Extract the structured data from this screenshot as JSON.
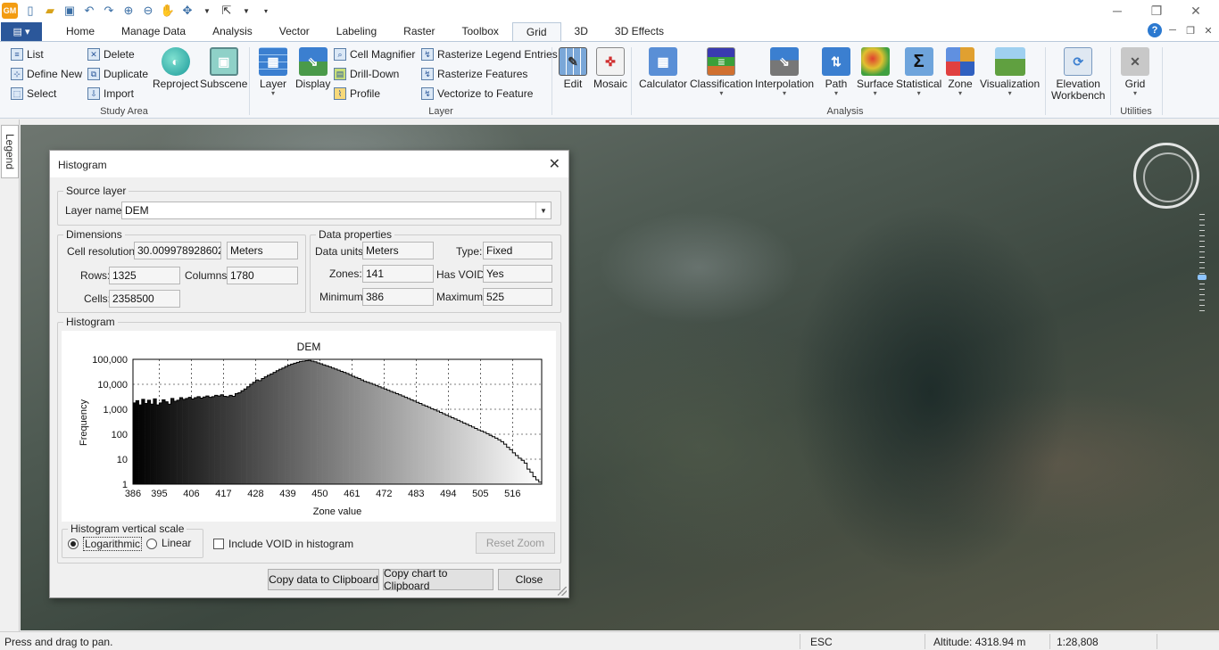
{
  "ribbon_tabs": [
    "Home",
    "Manage Data",
    "Analysis",
    "Vector",
    "Labeling",
    "Raster",
    "Toolbox",
    "Grid",
    "3D",
    "3D Effects"
  ],
  "active_tab": "Grid",
  "study_area": {
    "list": "List",
    "define_new": "Define New",
    "select": "Select",
    "delete": "Delete",
    "duplicate": "Duplicate",
    "import": "Import",
    "reproject": "Reproject",
    "subscene": "Subscene",
    "label": "Study Area"
  },
  "layer_group": {
    "layer": "Layer",
    "display": "Display",
    "cell_magnifier": "Cell Magnifier",
    "drill_down": "Drill-Down",
    "profile": "Profile",
    "rasterize_legend": "Rasterize Legend Entries",
    "rasterize_features": "Rasterize Features",
    "vectorize": "Vectorize to Feature",
    "label": "Layer"
  },
  "edit_group": {
    "edit": "Edit",
    "mosaic": "Mosaic"
  },
  "analysis_group": {
    "calculator": "Calculator",
    "classification": "Classification",
    "interpolation": "Interpolation",
    "path": "Path",
    "surface": "Surface",
    "statistical": "Statistical",
    "zone": "Zone",
    "visualization": "Visualization",
    "elevation_workbench_1": "Elevation",
    "elevation_workbench_2": "Workbench",
    "label": "Analysis"
  },
  "utilities_group": {
    "grid": "Grid",
    "label": "Utilities"
  },
  "legend_tab": "Legend",
  "dialog": {
    "title": "Histogram",
    "source_layer": {
      "legend": "Source layer",
      "label": "Layer name:",
      "value": "DEM"
    },
    "dimensions": {
      "legend": "Dimensions",
      "cell_resolution_label": "Cell resolution:",
      "cell_resolution": "30.009978928602",
      "units": "Meters",
      "rows_label": "Rows:",
      "rows": "1325",
      "columns_label": "Columns:",
      "columns": "1780",
      "cells_label": "Cells:",
      "cells": "2358500"
    },
    "data_properties": {
      "legend": "Data properties",
      "data_units_label": "Data units:",
      "data_units": "Meters",
      "type_label": "Type:",
      "type": "Fixed",
      "zones_label": "Zones:",
      "zones": "141",
      "has_void_label": "Has VOID:",
      "has_void": "Yes",
      "minimum_label": "Minimum:",
      "minimum": "386",
      "maximum_label": "Maximum:",
      "maximum": "525"
    },
    "histogram_legend": "Histogram",
    "vertical_scale": {
      "legend": "Histogram vertical scale",
      "logarithmic": "Logarithmic",
      "linear": "Linear",
      "selected": "Logarithmic"
    },
    "include_void": "Include VOID in histogram",
    "include_void_checked": false,
    "reset_zoom": "Reset Zoom",
    "copy_data": "Copy data to Clipboard",
    "copy_chart": "Copy chart to Clipboard",
    "close": "Close"
  },
  "chart_data": {
    "type": "bar",
    "title": "DEM",
    "xlabel": "Zone value",
    "ylabel": "Frequency",
    "y_scale": "log",
    "ylim": [
      1,
      100000
    ],
    "xlim": [
      386,
      525
    ],
    "x_ticks": [
      "386",
      "395",
      "406",
      "417",
      "428",
      "439",
      "450",
      "461",
      "472",
      "483",
      "494",
      "505",
      "516"
    ],
    "y_ticks": [
      "1",
      "10",
      "100",
      "1,000",
      "10,000",
      "100,000"
    ],
    "grid": true,
    "fill": "gradient black to white",
    "x": [
      386,
      387,
      388,
      389,
      390,
      391,
      392,
      393,
      394,
      395,
      396,
      397,
      398,
      399,
      400,
      401,
      402,
      403,
      404,
      405,
      406,
      407,
      408,
      409,
      410,
      411,
      412,
      413,
      414,
      415,
      416,
      417,
      418,
      419,
      420,
      421,
      422,
      423,
      424,
      425,
      426,
      427,
      428,
      429,
      430,
      431,
      432,
      433,
      434,
      435,
      436,
      437,
      438,
      439,
      440,
      441,
      442,
      443,
      444,
      445,
      446,
      447,
      448,
      449,
      450,
      451,
      452,
      453,
      454,
      455,
      456,
      457,
      458,
      459,
      460,
      461,
      462,
      463,
      464,
      465,
      466,
      467,
      468,
      469,
      470,
      471,
      472,
      473,
      474,
      475,
      476,
      477,
      478,
      479,
      480,
      481,
      482,
      483,
      484,
      485,
      486,
      487,
      488,
      489,
      490,
      491,
      492,
      493,
      494,
      495,
      496,
      497,
      498,
      499,
      500,
      501,
      502,
      503,
      504,
      505,
      506,
      507,
      508,
      509,
      510,
      511,
      512,
      513,
      514,
      515,
      516,
      517,
      518,
      519,
      520,
      521,
      522,
      523,
      524,
      525
    ],
    "values": [
      1800,
      2200,
      1500,
      2500,
      1700,
      2300,
      1600,
      2600,
      1500,
      1800,
      2400,
      2000,
      1600,
      2700,
      2100,
      2300,
      2900,
      2500,
      2700,
      3000,
      2600,
      2900,
      3200,
      2800,
      3100,
      3400,
      3000,
      3200,
      3600,
      3400,
      3800,
      3300,
      3200,
      3600,
      3300,
      4200,
      4600,
      5500,
      6500,
      8000,
      10000,
      12000,
      15000,
      14000,
      17000,
      20000,
      23000,
      26000,
      30000,
      35000,
      40000,
      45000,
      52000,
      58000,
      64000,
      70000,
      76000,
      82000,
      85000,
      88000,
      90000,
      85000,
      80000,
      72000,
      66000,
      60000,
      55000,
      50000,
      45000,
      41000,
      37000,
      33000,
      30000,
      27000,
      24000,
      21000,
      19000,
      17000,
      15000,
      13000,
      12000,
      11000,
      10000,
      9000,
      8000,
      7200,
      6500,
      5800,
      5200,
      4700,
      4200,
      3800,
      3400,
      3000,
      2700,
      2400,
      2150,
      1900,
      1700,
      1500,
      1350,
      1200,
      1050,
      950,
      850,
      750,
      660,
      580,
      520,
      460,
      410,
      360,
      320,
      280,
      250,
      220,
      195,
      170,
      150,
      135,
      120,
      105,
      90,
      80,
      70,
      60,
      50,
      40,
      30,
      24,
      18,
      14,
      11,
      9,
      7,
      4,
      3,
      2,
      1.5,
      1.2
    ]
  },
  "status": {
    "message": "Press and drag to pan.",
    "esc": "ESC",
    "altitude": "Altitude: 4318.94 m",
    "scale": "1:28,808"
  }
}
